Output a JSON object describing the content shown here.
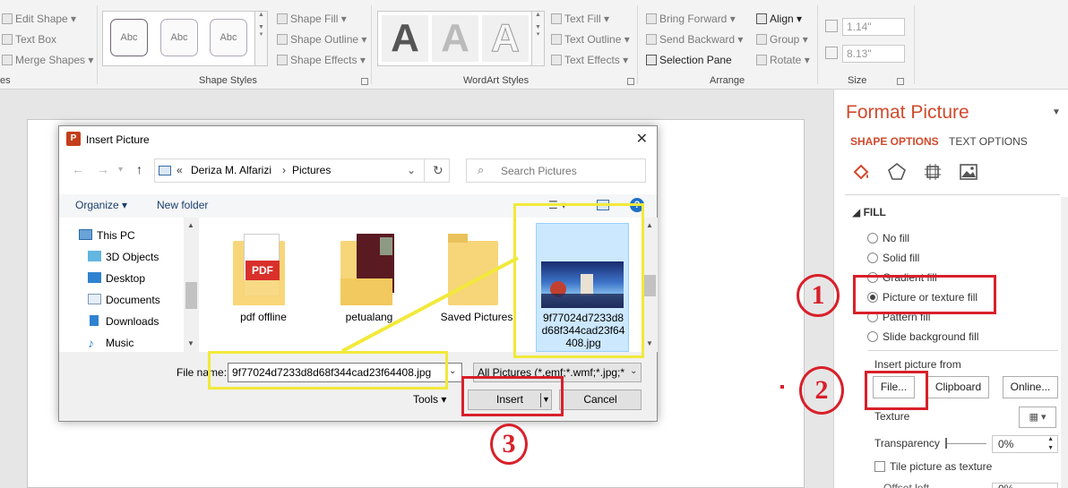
{
  "ribbon": {
    "insert_shapes": {
      "edit_shape": "Edit Shape",
      "text_box": "Text Box",
      "merge_shapes": "Merge Shapes",
      "group_label_partial": "es"
    },
    "shape_styles": {
      "swatch_text": "Abc",
      "shape_fill": "Shape Fill",
      "shape_outline": "Shape Outline",
      "shape_effects": "Shape Effects",
      "group_label": "Shape Styles"
    },
    "wordart": {
      "letter": "A",
      "text_fill": "Text Fill",
      "text_outline": "Text Outline",
      "text_effects": "Text Effects",
      "group_label": "WordArt Styles"
    },
    "arrange": {
      "bring_forward": "Bring Forward",
      "send_backward": "Send Backward",
      "selection_pane": "Selection Pane",
      "align": "Align",
      "group": "Group",
      "rotate": "Rotate",
      "group_label": "Arrange"
    },
    "size": {
      "height": "1.14\"",
      "width": "8.13\"",
      "group_label": "Size"
    }
  },
  "pane": {
    "title": "Format Picture",
    "tabs": [
      "SHAPE OPTIONS",
      "TEXT OPTIONS"
    ],
    "section": "FILL",
    "fill_options": [
      {
        "label": "No fill",
        "selected": false
      },
      {
        "label": "Solid fill",
        "selected": false
      },
      {
        "label": "Gradient fill",
        "selected": false
      },
      {
        "label": "Picture or texture fill",
        "selected": true
      },
      {
        "label": "Pattern fill",
        "selected": false
      },
      {
        "label": "Slide background fill",
        "selected": false
      }
    ],
    "insert_from": "Insert picture from",
    "file_btn": "File...",
    "clipboard_btn": "Clipboard",
    "online_btn": "Online...",
    "texture": "Texture",
    "transparency": "Transparency",
    "transparency_value": "0%",
    "tile": "Tile picture as texture",
    "offset_partial": "Offset left",
    "offset_value": "0%"
  },
  "dialog": {
    "title": "Insert Picture",
    "breadcrumb": [
      "Deriza M. Alfarizi",
      "Pictures"
    ],
    "search_placeholder": "Search Pictures",
    "organize": "Organize",
    "new_folder": "New folder",
    "nav_items": [
      "This PC",
      "3D Objects",
      "Desktop",
      "Documents",
      "Downloads",
      "Music"
    ],
    "files": [
      {
        "name": "pdf offline",
        "kind": "pdf-folder"
      },
      {
        "name": "petualang",
        "kind": "photo-folder"
      },
      {
        "name": "Saved Pictures",
        "kind": "folder"
      },
      {
        "name": "9f77024d7233d8d68f344cad23f64408.jpg",
        "kind": "image",
        "selected": true
      }
    ],
    "file_name_label": "File name:",
    "file_name_value": "9f77024d7233d8d68f344cad23f64408.jpg",
    "file_type": "All Pictures (*.emf;*.wmf;*.jpg;*",
    "tools": "Tools",
    "insert": "Insert",
    "cancel": "Cancel"
  },
  "annotations": {
    "step1": "1",
    "step2": "2",
    "step3": "3"
  },
  "colors": {
    "accent": "#d04a2c",
    "highlight_yellow": "#f2e93a",
    "highlight_red": "#d8202a"
  }
}
